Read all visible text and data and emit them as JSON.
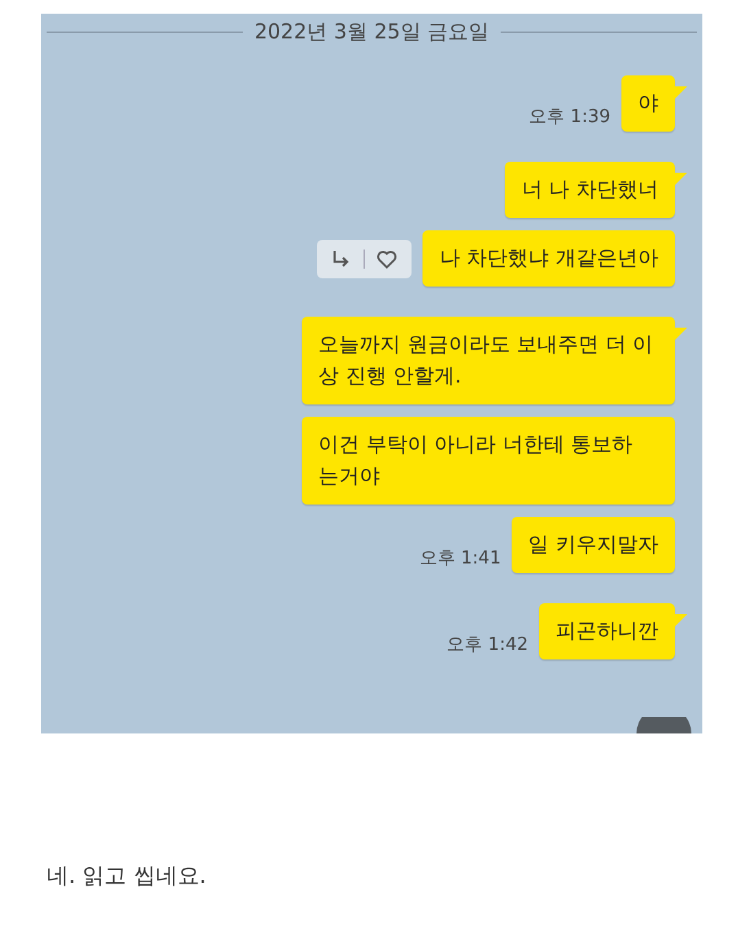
{
  "chat": {
    "date": "2022년 3월 25일 금요일",
    "messages": [
      {
        "text": "야",
        "time": "오후 1:39",
        "tail": true,
        "reactions": false
      },
      {
        "text": "너 나 차단했너",
        "tail": true,
        "reactions": false
      },
      {
        "text": "나 차단했냐 개같은년아",
        "tail": false,
        "reactions": true
      },
      {
        "text": "오늘까지 원금이라도 보내주면 더 이상 진행 안할게.",
        "tail": true,
        "reactions": false
      },
      {
        "text": "이건 부탁이 아니라 너한테 통보하 는거야",
        "tail": false,
        "reactions": false
      },
      {
        "text": "일 키우지말자",
        "time": "오후 1:41",
        "tail": false,
        "reactions": false
      },
      {
        "text": "피곤하니깐",
        "time": "오후 1:42",
        "tail": true,
        "reactions": false
      }
    ]
  },
  "caption": "네. 읽고 씹네요."
}
